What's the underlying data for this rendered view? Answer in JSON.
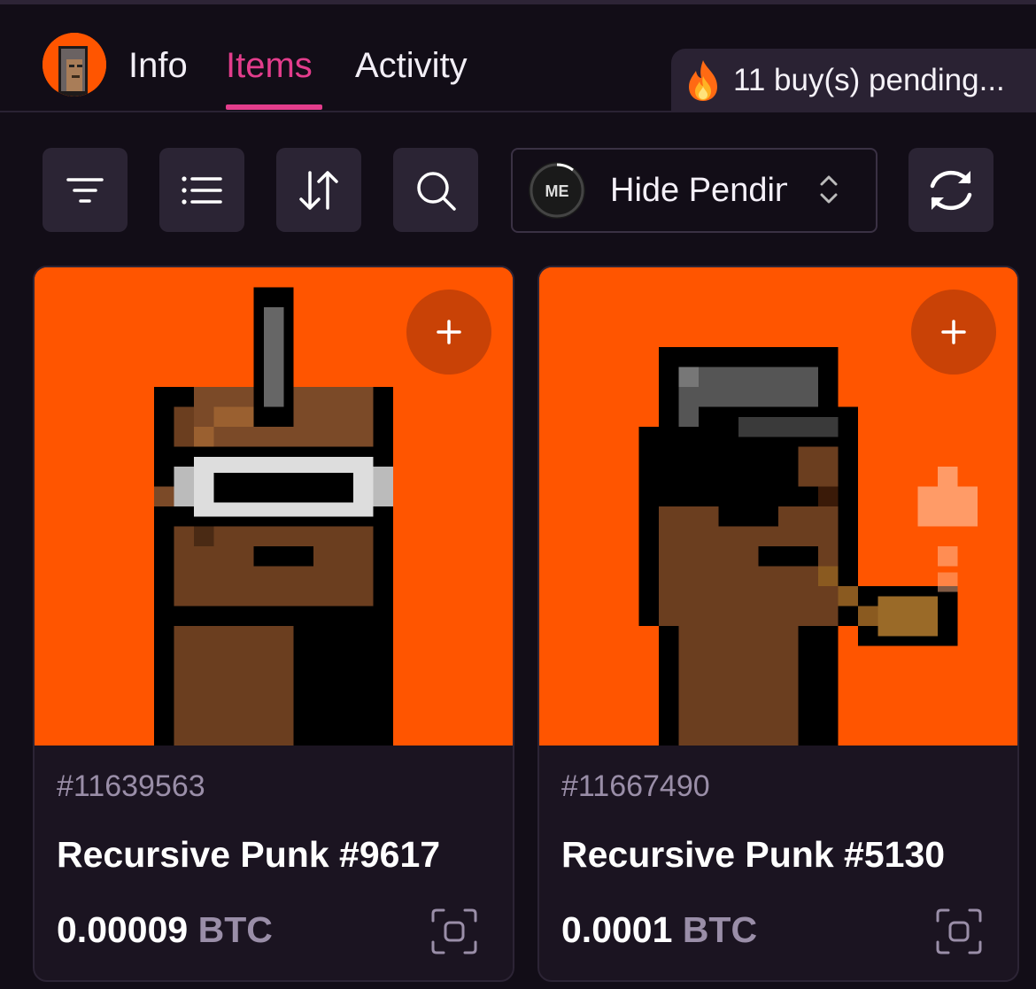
{
  "nav": {
    "tabs": [
      {
        "label": "Info",
        "active": false
      },
      {
        "label": "Items",
        "active": true
      },
      {
        "label": "Activity",
        "active": false
      }
    ],
    "pending": {
      "icon": "fire-icon",
      "text": "11 buy(s) pending..."
    }
  },
  "toolbar": {
    "filter_icon": "filter-icon",
    "list_icon": "list-icon",
    "sort_icon": "sort-icon",
    "search_icon": "search-icon",
    "select": {
      "logo": "magic-eden-logo",
      "value": "Hide Pending",
      "icon": "chevron-updown-icon"
    },
    "refresh_icon": "refresh-icon"
  },
  "cards": [
    {
      "id": "#11639563",
      "name": "Recursive Punk #9617",
      "price": "0.00009",
      "currency": "BTC"
    },
    {
      "id": "#11667490",
      "name": "Recursive Punk #5130",
      "price": "0.0001",
      "currency": "BTC"
    }
  ],
  "colors": {
    "accent": "#e33d8c",
    "background": "#120d17",
    "art_background": "#ff5500"
  }
}
